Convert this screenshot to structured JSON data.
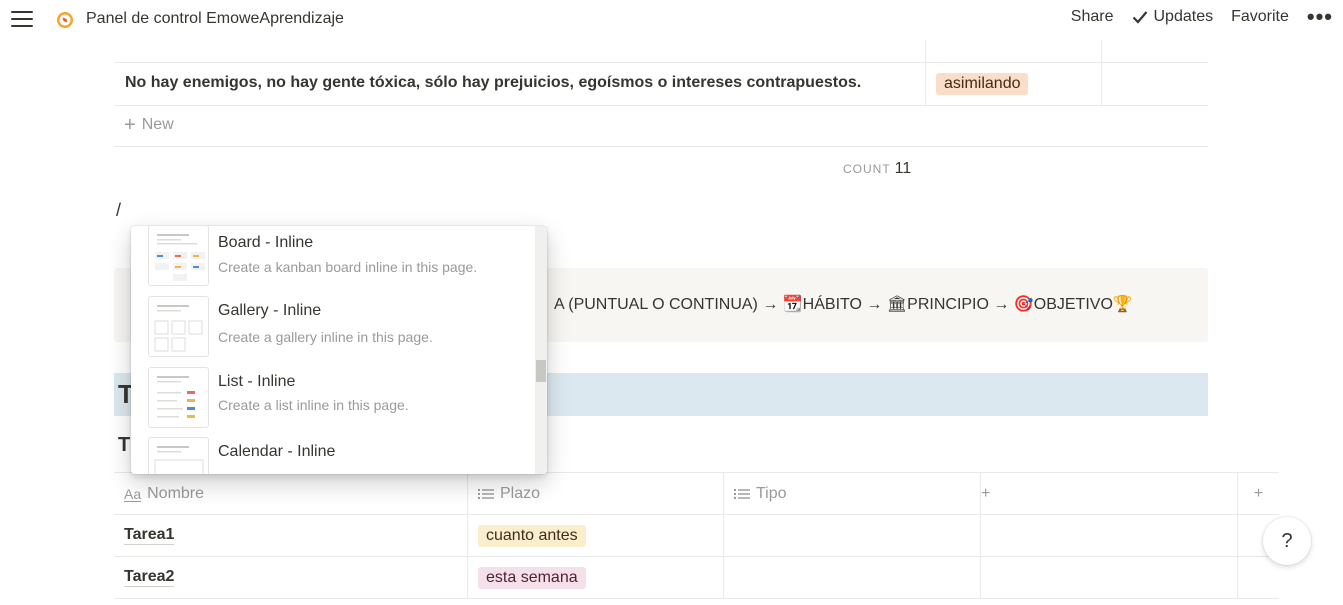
{
  "topbar": {
    "title": "Panel de control EmoweAprendizaje",
    "share": "Share",
    "updates": "Updates",
    "favorite": "Favorite"
  },
  "upper_table": {
    "row": {
      "text": "No hay enemigos, no hay gente tóxica, sólo hay prejuicios, egoísmos o intereses contrapuestos.",
      "tag": "asimilando",
      "tag_color": "#fadec9"
    },
    "new_label": "New",
    "count_label": "COUNT",
    "count_value": "11"
  },
  "editor": {
    "slash": "/"
  },
  "callout": {
    "text": "A (PUNTUAL O CONTINUA) → 📆HÁBITO → 🏛PRINCIPIO → 🎯OBJETIVO🏆"
  },
  "heading": {
    "visible_letter": "T",
    "sub_letter": "T"
  },
  "menu": {
    "items": [
      {
        "title": "Board - Inline",
        "desc": "Create a kanban board inline in this page.",
        "icon": "board-thumbnail"
      },
      {
        "title": "Gallery - Inline",
        "desc": "Create a gallery inline in this page.",
        "icon": "gallery-thumbnail"
      },
      {
        "title": "List - Inline",
        "desc": "Create a list inline in this page.",
        "icon": "list-thumbnail"
      },
      {
        "title": "Calendar - Inline",
        "desc": "",
        "icon": "calendar-thumbnail"
      }
    ]
  },
  "lower_table": {
    "columns": [
      {
        "label": "Nombre",
        "icon": "Aa"
      },
      {
        "label": "Plazo",
        "icon": "list-icon"
      },
      {
        "label": "Tipo",
        "icon": "list-icon"
      }
    ],
    "rows": [
      {
        "name": "Tarea1",
        "plazo": "cuanto antes",
        "plazo_color": "#fbeecc"
      },
      {
        "name": "Tarea2",
        "plazo": "esta semana",
        "plazo_color": "#f5e0e9"
      }
    ]
  },
  "help": {
    "label": "?"
  }
}
